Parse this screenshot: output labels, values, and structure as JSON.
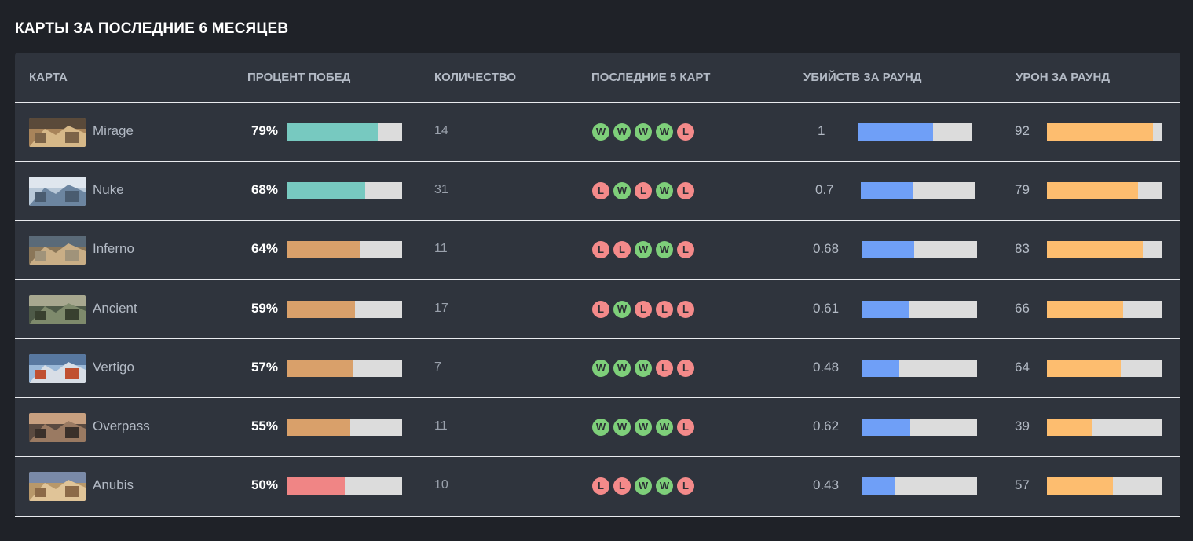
{
  "title": "КАРТЫ ЗА ПОСЛЕДНИЕ 6 МЕСЯЦЕВ",
  "columns": {
    "map": "КАРТА",
    "winrate": "ПРОЦЕНТ ПОБЕД",
    "count": "КОЛИЧЕСТВО",
    "last5": "ПОСЛЕДНИЕ 5 КАРТ",
    "kpr": "УБИЙСТВ ЗА РАУНД",
    "adr": "УРОН ЗА РАУНД"
  },
  "colors": {
    "win_teal": "#77c9c0",
    "win_orange": "#d9a06a",
    "win_red": "#f08585",
    "kpr_blue": "#6f9ff7",
    "adr_orange": "#fdbd6f",
    "result_w": "#7ecf7a",
    "result_l": "#f48a8a"
  },
  "rows": [
    {
      "map": "Mirage",
      "thumb": "mirage-thumbnail",
      "winrate": "79%",
      "winrate_value": 0.79,
      "count": "14",
      "last5": [
        "W",
        "W",
        "W",
        "W",
        "L"
      ],
      "kpr": "1",
      "kpr_fill": 0.66,
      "adr": "92",
      "adr_fill": 0.92
    },
    {
      "map": "Nuke",
      "thumb": "nuke-thumbnail",
      "winrate": "68%",
      "winrate_value": 0.68,
      "count": "31",
      "last5": [
        "L",
        "W",
        "L",
        "W",
        "L"
      ],
      "kpr": "0.7",
      "kpr_fill": 0.46,
      "adr": "79",
      "adr_fill": 0.79
    },
    {
      "map": "Inferno",
      "thumb": "inferno-thumbnail",
      "winrate": "64%",
      "winrate_value": 0.64,
      "count": "11",
      "last5": [
        "L",
        "L",
        "W",
        "W",
        "L"
      ],
      "kpr": "0.68",
      "kpr_fill": 0.45,
      "adr": "83",
      "adr_fill": 0.83
    },
    {
      "map": "Ancient",
      "thumb": "ancient-thumbnail",
      "winrate": "59%",
      "winrate_value": 0.59,
      "count": "17",
      "last5": [
        "L",
        "W",
        "L",
        "L",
        "L"
      ],
      "kpr": "0.61",
      "kpr_fill": 0.41,
      "adr": "66",
      "adr_fill": 0.66
    },
    {
      "map": "Vertigo",
      "thumb": "vertigo-thumbnail",
      "winrate": "57%",
      "winrate_value": 0.57,
      "count": "7",
      "last5": [
        "W",
        "W",
        "W",
        "L",
        "L"
      ],
      "kpr": "0.48",
      "kpr_fill": 0.32,
      "adr": "64",
      "adr_fill": 0.64
    },
    {
      "map": "Overpass",
      "thumb": "overpass-thumbnail",
      "winrate": "55%",
      "winrate_value": 0.55,
      "count": "11",
      "last5": [
        "W",
        "W",
        "W",
        "W",
        "L"
      ],
      "kpr": "0.62",
      "kpr_fill": 0.42,
      "adr": "39",
      "adr_fill": 0.39
    },
    {
      "map": "Anubis",
      "thumb": "anubis-thumbnail",
      "winrate": "50%",
      "winrate_value": 0.5,
      "count": "10",
      "last5": [
        "L",
        "L",
        "W",
        "W",
        "L"
      ],
      "kpr": "0.43",
      "kpr_fill": 0.29,
      "adr": "57",
      "adr_fill": 0.57
    }
  ]
}
